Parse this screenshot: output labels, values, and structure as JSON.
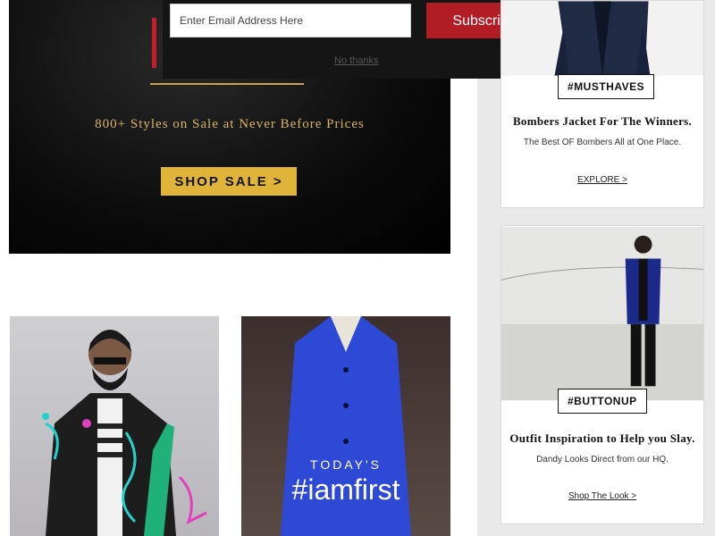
{
  "popup": {
    "email_placeholder": "Enter Email Address Here",
    "subscribe_label": "Subscribe",
    "no_thanks_label": "No thanks"
  },
  "hero": {
    "tagline": "800+ Styles on Sale at Never Before Prices",
    "cta_label": "SHOP SALE >"
  },
  "cards": [
    {
      "tag": "#MUSTHAVES",
      "title": "Bombers Jacket For The Winners.",
      "subtitle": "The Best OF Bombers All at One Place.",
      "link": "EXPLORE >"
    },
    {
      "tag": "#BUTTONUP",
      "title": "Outfit Inspiration to Help you Slay.",
      "subtitle": "Dandy Looks Direct from our HQ.",
      "link": "Shop The Look >"
    }
  ],
  "promos": {
    "today_label": "TODAY'S",
    "hashtag": "#iamfirst"
  },
  "colors": {
    "accent_red": "#b11c25",
    "accent_gold": "#e0b43a",
    "tagline_gold": "#d8b56a"
  }
}
